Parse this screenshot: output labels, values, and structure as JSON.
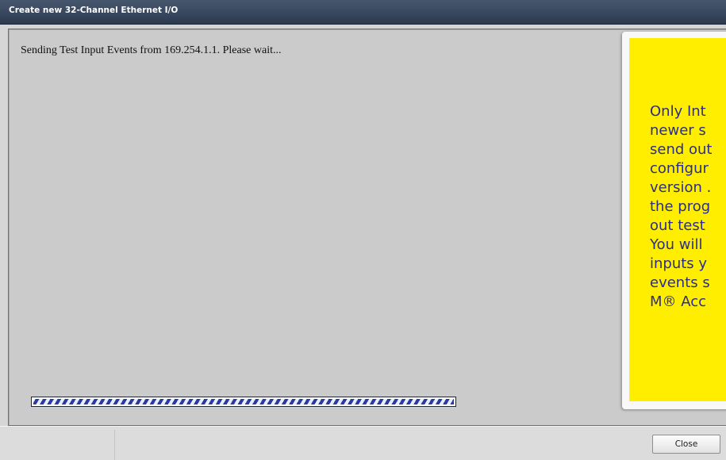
{
  "window": {
    "title": "Create new 32-Channel Ethernet I/O"
  },
  "main": {
    "status_message": "Sending Test Input Events from 169.254.1.1. Please wait...",
    "progress": "indeterminate"
  },
  "note": {
    "lines": [
      "Only Int",
      "newer s",
      "send out",
      "configur",
      "version .",
      "the prog",
      "out test",
      "You will",
      "inputs y",
      "events s",
      "M® Acc"
    ]
  },
  "footer": {
    "close_label": "Close"
  },
  "colors": {
    "titlebar": "#2f3c52",
    "note_background": "#ffee00",
    "note_text": "#2a2d8a",
    "progress_stripe": "#2b3a9e"
  }
}
